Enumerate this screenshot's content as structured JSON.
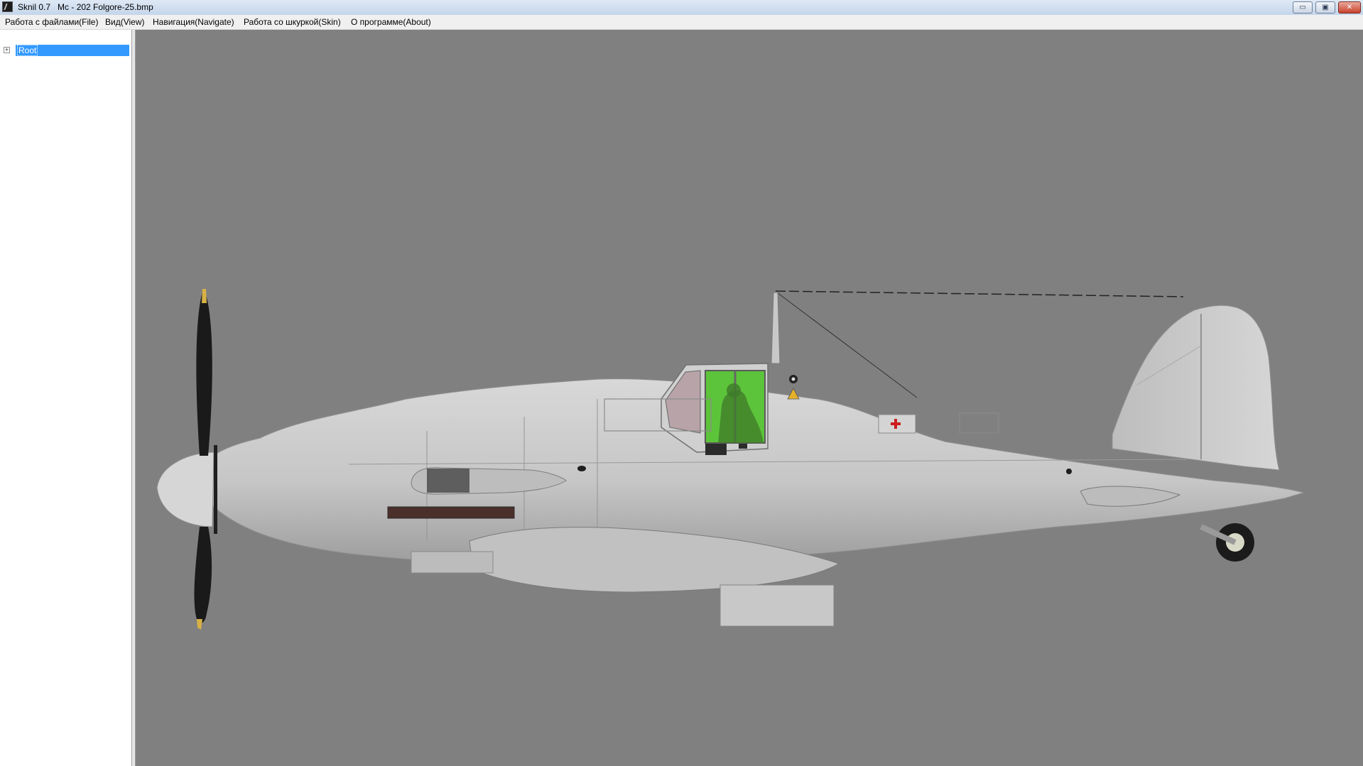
{
  "window": {
    "title": "Sknil 0.7   Mc - 202 Folgore-25.bmp",
    "buttons": {
      "minimize": "▭",
      "maximize": "▣",
      "close": "✕"
    }
  },
  "menu": {
    "file": "Работа с файлами(File)",
    "view": "Вид(View)",
    "navigate": "Навигация(Navigate)",
    "skin": "Работа со шкуркой(Skin)",
    "about": "О программе(About)"
  },
  "tree": {
    "root_label": "Root",
    "expander": "+"
  },
  "colors": {
    "viewport_bg": "#808080",
    "selection": "#3399ff",
    "fuselage": "#c9c9c9",
    "canopy_glass": "#5cc43a",
    "propeller": "#1a1a1a"
  },
  "icons": {
    "app": "app-icon",
    "expand": "plus-box-icon"
  }
}
